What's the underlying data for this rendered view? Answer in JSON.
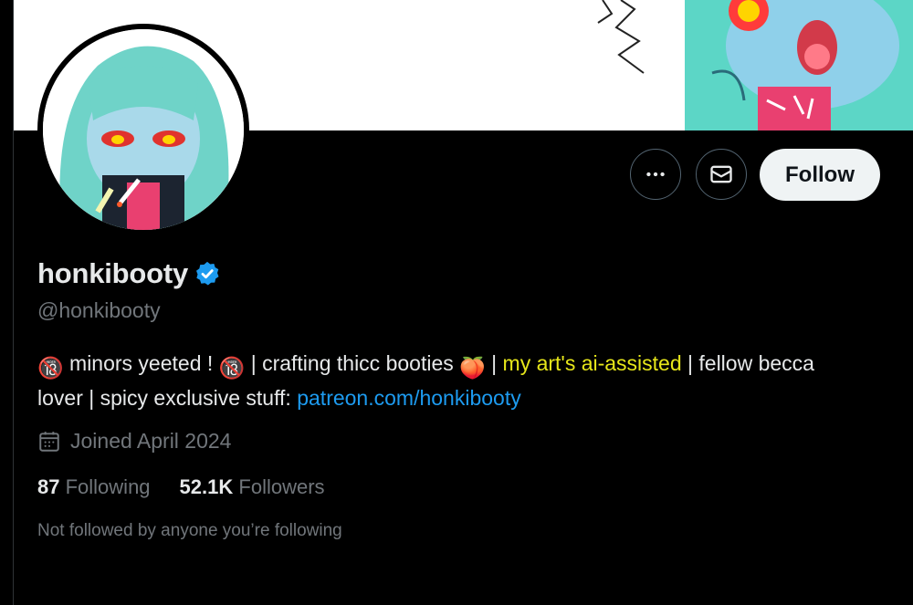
{
  "profile": {
    "display_name": "honkibooty",
    "handle": "@honkibooty",
    "verified_icon": "verified-badge-icon"
  },
  "actions": {
    "more_icon": "more-dots-icon",
    "message_icon": "envelope-icon",
    "follow_label": "Follow"
  },
  "bio": {
    "part1": " minors yeeted ! ",
    "part2": " | crafting thicc booties ",
    "part3": " | ",
    "highlight": "my art's ai-assisted",
    "part4": " | fellow becca lover | spicy exclusive stuff: ",
    "link": "patreon.com/honkibooty",
    "emoji_18": "🔞",
    "emoji_peach": "🍑"
  },
  "joined": {
    "icon": "calendar-icon",
    "text": "Joined April 2024"
  },
  "stats": {
    "following_count": "87",
    "following_label": "Following",
    "followers_count": "52.1K",
    "followers_label": "Followers"
  },
  "social_context": "Not followed by anyone you’re following",
  "colors": {
    "background": "#000000",
    "text": "#e7e9ea",
    "muted": "#71767b",
    "link": "#1d9bf0",
    "highlight": "#e6e61a",
    "verified": "#1d9bf0"
  }
}
